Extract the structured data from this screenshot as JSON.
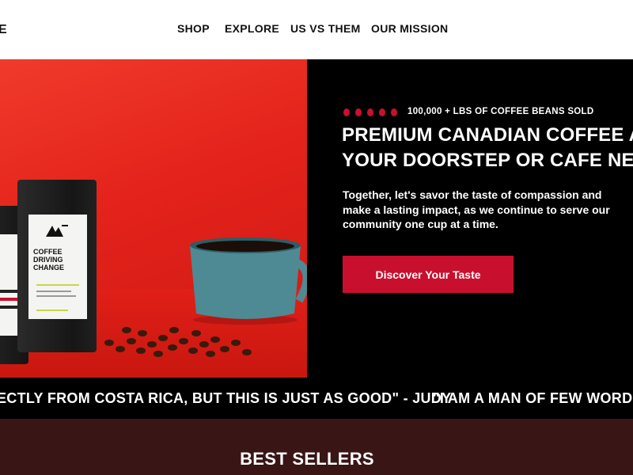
{
  "header": {
    "logo_fragment": "E",
    "nav": [
      {
        "label": "SHOP"
      },
      {
        "label": "EXPLORE"
      },
      {
        "label": "US VS THEM"
      },
      {
        "label": "OUR MISSION"
      }
    ]
  },
  "hero": {
    "sold_badge": "100,000 + LBS OF COFFEE BEANS SOLD",
    "headline_line1": "PREMIUM CANADIAN COFFEE AT",
    "headline_line2": "YOUR DOORSTEP OR CAFE NEAR YOU",
    "body": "Together, let's savor the taste of compassion and make a lasting impact, as we continue to serve our community one cup at a time.",
    "cta_label": "Discover Your Taste",
    "bag_label_lines": [
      "COFFEE",
      "DRIVING",
      "CHANGE"
    ],
    "colors": {
      "accent": "#c8102e",
      "hero_red": "#e8251f",
      "dark": "#000000"
    }
  },
  "marquee": {
    "quote1": "ECTLY FROM COSTA RICA, BUT THIS IS JUST AS GOOD\" - JUDY",
    "quote2": "\"I AM A MAN OF FEW WORDS."
  },
  "best_sellers": {
    "title": "BEST SELLERS",
    "background": "#3a1516"
  }
}
